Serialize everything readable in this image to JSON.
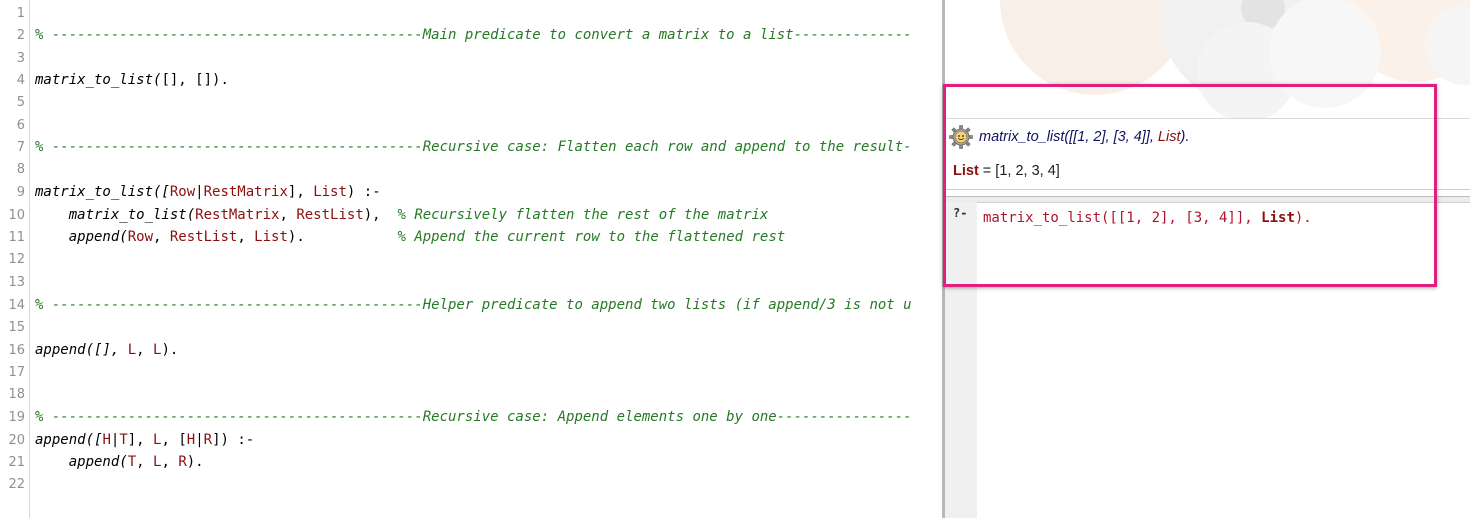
{
  "editor": {
    "line_numbers": [
      "1",
      "2",
      "3",
      "4",
      "5",
      "6",
      "7",
      "8",
      "9",
      "10",
      "11",
      "12",
      "13",
      "14",
      "15",
      "16",
      "17",
      "18",
      "19",
      "20",
      "21",
      "22"
    ],
    "lines": {
      "l2": "% --------------------------------------------Main predicate to convert a matrix to a list--------------",
      "l4a": "matrix_to_list(",
      "l4b": "[], []).",
      "l7": "% --------------------------------------------Recursive case: Flatten each row and append to the result-",
      "l9a": "matrix_to_list([",
      "l9b": "Row",
      "l9c": "|",
      "l9d": "RestMatrix",
      "l9e": "], ",
      "l9f": "List",
      "l9g": ") :-",
      "l10a": "    matrix_to_list(",
      "l10b": "RestMatrix",
      "l10c": ", ",
      "l10d": "RestList",
      "l10e": "),  ",
      "l10f": "% Recursively flatten the rest of the matrix",
      "l11a": "    append(",
      "l11b": "Row",
      "l11c": ", ",
      "l11d": "RestList",
      "l11e": ", ",
      "l11f": "List",
      "l11g": ").           ",
      "l11h": "% Append the current row to the flattened rest",
      "l14": "% --------------------------------------------Helper predicate to append two lists (if append/3 is not u",
      "l16a": "append([], ",
      "l16b": "L",
      "l16c": ", ",
      "l16d": "L",
      "l16e": ").",
      "l19": "% --------------------------------------------Recursive case: Append elements one by one----------------",
      "l20a": "append([",
      "l20b": "H",
      "l20c": "|",
      "l20d": "T",
      "l20e": "], ",
      "l20f": "L",
      "l20g": ", [",
      "l20h": "H",
      "l20i": "|",
      "l20j": "R",
      "l20k": "]) :-",
      "l21a": "    append(",
      "l21b": "T",
      "l21c": ", ",
      "l21d": "L",
      "l21e": ", ",
      "l21f": "R",
      "l21g": ")."
    }
  },
  "query_pane": {
    "history_query_prefix": "matrix_to_list([[1, 2], [3, 4]], ",
    "history_query_var": "List",
    "history_query_suffix": ").",
    "answer_label": "List",
    "answer_value": " = [1, 2, 3, 4]",
    "prompt": "?-",
    "input_prefix": "matrix_to_list([[1, 2], [3, 4]], ",
    "input_var": "List",
    "input_suffix": ").",
    "gear_icon": "gear-icon",
    "colors": {
      "highlight": "#e0207e",
      "variable": "#8a0f0f",
      "comment": "#267a26"
    }
  }
}
